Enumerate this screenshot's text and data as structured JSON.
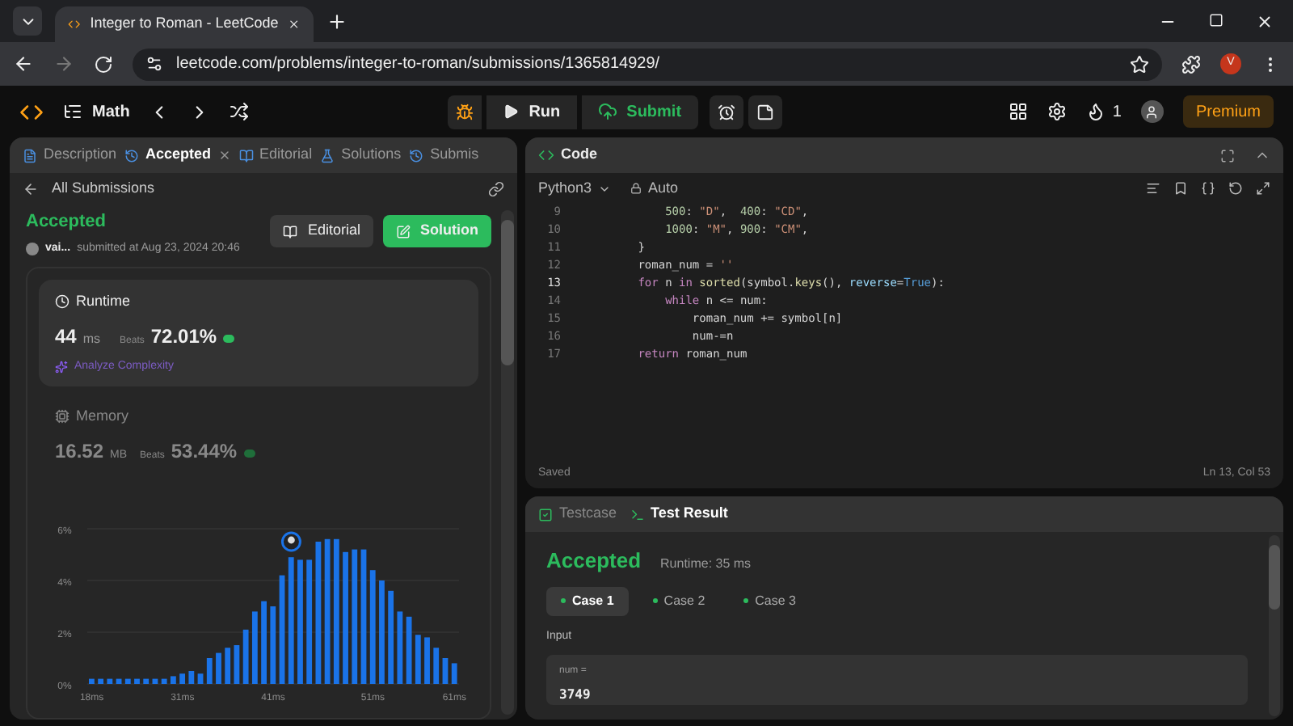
{
  "browser": {
    "tab_title": "Integer to Roman - LeetCode",
    "url": "leetcode.com/problems/integer-to-roman/submissions/1365814929/",
    "profile_initial": "V"
  },
  "toolbar": {
    "problem_list": "Math",
    "run": "Run",
    "submit": "Submit",
    "streak": "1",
    "premium": "Premium"
  },
  "left_tabs": [
    {
      "label": "Description",
      "selected": false,
      "closable": false
    },
    {
      "label": "Accepted",
      "selected": true,
      "closable": true
    },
    {
      "label": "Editorial",
      "selected": false,
      "closable": false
    },
    {
      "label": "Solutions",
      "selected": false,
      "closable": false
    },
    {
      "label": "Submis",
      "selected": false,
      "closable": false
    }
  ],
  "back_link": "All Submissions",
  "submission": {
    "status": "Accepted",
    "user": "vai...",
    "submitted": "submitted at Aug 23, 2024 20:46",
    "editorial_button": "Editorial",
    "solution_button": "Solution"
  },
  "runtime": {
    "title": "Runtime",
    "value": "44",
    "unit": "ms",
    "beats_label": "Beats",
    "beats": "72.01%",
    "analyze": "Analyze Complexity"
  },
  "memory": {
    "title": "Memory",
    "value": "16.52",
    "unit": "MB",
    "beats_label": "Beats",
    "beats": "53.44%"
  },
  "chart_data": {
    "type": "bar",
    "categories": [
      "18ms",
      null,
      null,
      null,
      null,
      null,
      null,
      null,
      null,
      null,
      "31ms",
      null,
      null,
      null,
      null,
      null,
      null,
      null,
      null,
      null,
      "41ms",
      null,
      null,
      null,
      null,
      null,
      null,
      null,
      null,
      null,
      null,
      "51ms",
      null,
      null,
      null,
      null,
      null,
      null,
      null,
      null,
      "61ms"
    ],
    "series": [
      {
        "color": "#1a73e8",
        "values": [
          0.2,
          0.2,
          0.2,
          0.2,
          0.2,
          0.2,
          0.2,
          0.2,
          0.2,
          0.3,
          0.4,
          0.5,
          0.4,
          1.0,
          1.2,
          1.4,
          1.5,
          2.1,
          2.8,
          3.2,
          3.0,
          4.2,
          4.9,
          4.8,
          4.8,
          5.5,
          5.6,
          5.6,
          5.1,
          5.2,
          5.2,
          4.4,
          4.0,
          3.6,
          2.8,
          2.6,
          1.9,
          1.8,
          1.4,
          1.0,
          0.8
        ]
      }
    ],
    "ylim": [
      0,
      6
    ],
    "yticks": [
      {
        "value": 0,
        "label": "0%"
      },
      {
        "value": 2,
        "label": "2%"
      },
      {
        "value": 4,
        "label": "4%"
      },
      {
        "value": 6,
        "label": "6%"
      }
    ]
  },
  "code": {
    "title": "Code",
    "language": "Python3",
    "mode": "Auto",
    "status": "Saved",
    "cursor": "Ln 13, Col 53",
    "lines": [
      {
        "number": "9",
        "current": false,
        "tokens": [
          {
            "text": "            500",
            "kind": "number"
          },
          {
            "text": ": ",
            "kind": "plain"
          },
          {
            "text": "\"D\"",
            "kind": "string"
          },
          {
            "text": ",  ",
            "kind": "plain"
          },
          {
            "text": "400",
            "kind": "number"
          },
          {
            "text": ": ",
            "kind": "plain"
          },
          {
            "text": "\"CD\"",
            "kind": "string"
          },
          {
            "text": ",",
            "kind": "plain"
          }
        ]
      },
      {
        "number": "10",
        "current": false,
        "tokens": [
          {
            "text": "            1000",
            "kind": "number"
          },
          {
            "text": ": ",
            "kind": "plain"
          },
          {
            "text": "\"M\"",
            "kind": "string"
          },
          {
            "text": ", ",
            "kind": "plain"
          },
          {
            "text": "900",
            "kind": "number"
          },
          {
            "text": ": ",
            "kind": "plain"
          },
          {
            "text": "\"CM\"",
            "kind": "string"
          },
          {
            "text": ",",
            "kind": "plain"
          }
        ]
      },
      {
        "number": "11",
        "current": false,
        "tokens": [
          {
            "text": "        }",
            "kind": "plain"
          }
        ]
      },
      {
        "number": "12",
        "current": false,
        "tokens": [
          {
            "text": "        roman_num = ",
            "kind": "plain"
          },
          {
            "text": "''",
            "kind": "string"
          }
        ]
      },
      {
        "number": "13",
        "current": true,
        "tokens": [
          {
            "text": "        for",
            "kind": "keyword"
          },
          {
            "text": " n ",
            "kind": "plain"
          },
          {
            "text": "in",
            "kind": "keyword"
          },
          {
            "text": " sorted",
            "kind": "func"
          },
          {
            "text": "(symbol.",
            "kind": "plain"
          },
          {
            "text": "keys",
            "kind": "func"
          },
          {
            "text": "(), ",
            "kind": "plain"
          },
          {
            "text": "reverse",
            "kind": "param"
          },
          {
            "text": "=",
            "kind": "plain"
          },
          {
            "text": "True",
            "kind": "const"
          },
          {
            "text": "):",
            "kind": "plain"
          }
        ]
      },
      {
        "number": "14",
        "current": false,
        "tokens": [
          {
            "text": "            while",
            "kind": "keyword"
          },
          {
            "text": " n <= num:",
            "kind": "plain"
          }
        ]
      },
      {
        "number": "15",
        "current": false,
        "tokens": [
          {
            "text": "                roman_num += symbol[n]",
            "kind": "plain"
          }
        ]
      },
      {
        "number": "16",
        "current": false,
        "tokens": [
          {
            "text": "                num-=n",
            "kind": "plain"
          }
        ]
      },
      {
        "number": "17",
        "current": false,
        "tokens": [
          {
            "text": "        return",
            "kind": "keyword"
          },
          {
            "text": " roman_num",
            "kind": "plain"
          }
        ]
      }
    ]
  },
  "test": {
    "tabs": [
      {
        "label": "Testcase",
        "selected": false
      },
      {
        "label": "Test Result",
        "selected": true
      }
    ],
    "result": "Accepted",
    "runtime": "Runtime: 35 ms",
    "cases": [
      {
        "label": "Case 1",
        "selected": true
      },
      {
        "label": "Case 2",
        "selected": false
      },
      {
        "label": "Case 3",
        "selected": false
      }
    ],
    "input_label": "Input",
    "inputs": [
      {
        "name": "num =",
        "value": "3749"
      }
    ]
  }
}
